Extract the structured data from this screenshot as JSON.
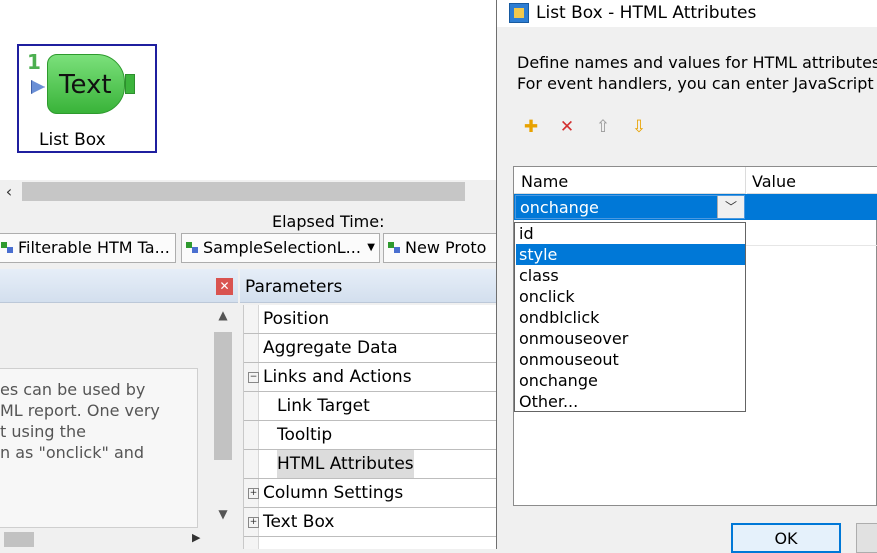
{
  "canvas": {
    "node_number": "1",
    "node_badge": "Text",
    "node_label": "List Box"
  },
  "status": {
    "elapsed": "Elapsed Time:"
  },
  "tabs": [
    {
      "label": "Filterable HTM Ta..."
    },
    {
      "label": "SampleSelectionL..."
    },
    {
      "label": "New Proto"
    }
  ],
  "help_lines": [
    "es can be used by",
    "ML report. One very",
    "t using the",
    "n as \"onclick\" and"
  ],
  "parameters": {
    "title": "Parameters",
    "items": [
      {
        "label": "Position",
        "indent": 0,
        "expander": "",
        "selected": false
      },
      {
        "label": "Aggregate Data",
        "indent": 0,
        "expander": "",
        "selected": false
      },
      {
        "label": "Links and Actions",
        "indent": 0,
        "expander": "−",
        "selected": false
      },
      {
        "label": "Link Target",
        "indent": 1,
        "expander": "",
        "selected": false
      },
      {
        "label": "Tooltip",
        "indent": 1,
        "expander": "",
        "selected": false
      },
      {
        "label": "HTML Attributes",
        "indent": 1,
        "expander": "",
        "selected": true
      },
      {
        "label": "Column Settings",
        "indent": 0,
        "expander": "+",
        "selected": false
      },
      {
        "label": "Text Box",
        "indent": 0,
        "expander": "+",
        "selected": false
      }
    ]
  },
  "dialog": {
    "title": "List Box - HTML Attributes",
    "desc_line1": "Define names and values for HTML attributes.",
    "desc_line2": "For event handlers, you can enter JavaScript dire",
    "toolbar": {
      "add": "✚",
      "delete": "✕",
      "up": "⇧",
      "down": "⇩"
    },
    "columns": {
      "name": "Name",
      "value": "Value"
    },
    "combo_value": "onchange",
    "dropdown_options": [
      "id",
      "style",
      "class",
      "onclick",
      "ondblclick",
      "onmouseover",
      "onmouseout",
      "onchange",
      "Other..."
    ],
    "dropdown_selected": "style",
    "ok_label": "OK"
  },
  "icons": {
    "close": "close-icon",
    "scroll_left": "chevron-left-icon",
    "scroll_right": "chevron-right-icon",
    "scroll_up": "chevron-up-icon",
    "scroll_down": "chevron-down-icon",
    "combo": "chevron-down-icon"
  },
  "colors": {
    "selection": "#0078d7",
    "node_green": "#4caf50",
    "close_red": "#d9534f"
  }
}
